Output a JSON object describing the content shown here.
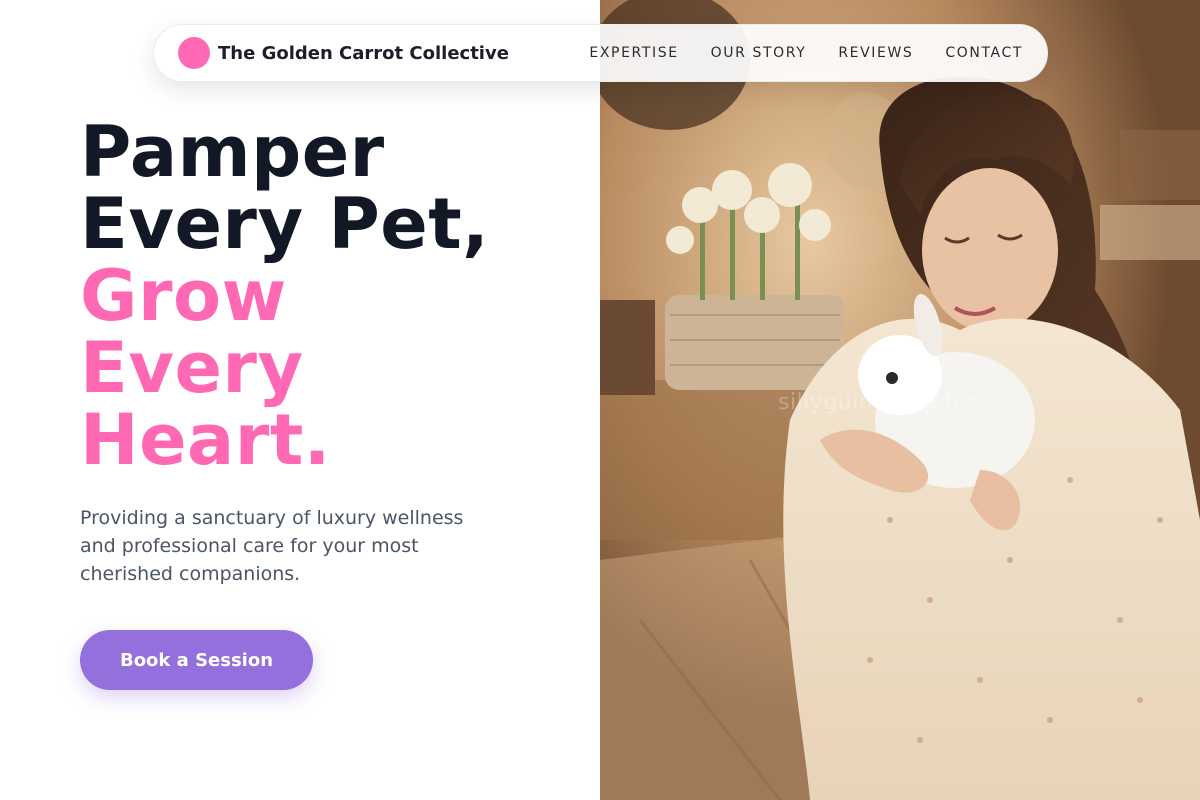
{
  "brand": {
    "name": "The Golden Carrot Collective",
    "logo_color": "#ff69b4"
  },
  "nav": {
    "links": [
      {
        "label": "EXPERTISE"
      },
      {
        "label": "OUR STORY"
      },
      {
        "label": "REVIEWS"
      },
      {
        "label": "CONTACT"
      }
    ]
  },
  "hero": {
    "headline_dark": [
      "Pamper",
      "Every Pet,"
    ],
    "headline_pink": [
      "Grow",
      "Every",
      "Heart."
    ],
    "subtitle": "Providing a sanctuary of luxury wellness and professional care for your most cherished companions.",
    "cta_label": "Book a Session"
  },
  "image": {
    "description_icon": "photo-woman-holding-rabbit",
    "watermark": "sillyguineapig.biz"
  },
  "colors": {
    "accent_pink": "#ff69b4",
    "cta_purple": "#9370db",
    "headline_dark": "#121826"
  }
}
